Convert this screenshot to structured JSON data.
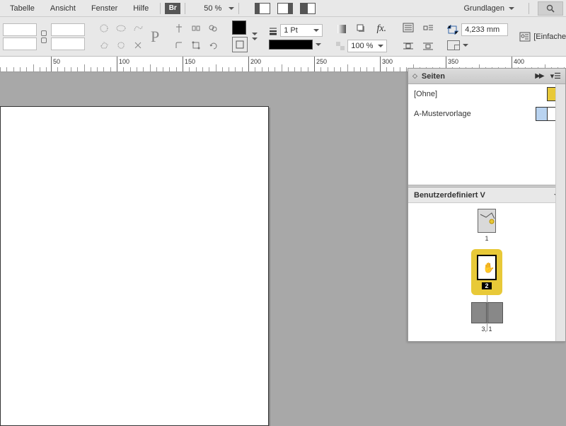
{
  "menu": {
    "items": [
      "Tabelle",
      "Ansicht",
      "Fenster",
      "Hilfe"
    ],
    "br": "Br",
    "zoom": "50 %",
    "workspace": "Grundlagen"
  },
  "toolbar": {
    "stroke_weight": "1 Pt",
    "opacity": "100 %",
    "mm_value": "4,233 mm",
    "graphic_style": "[Einfacher Grafik"
  },
  "ruler": {
    "ticks": [
      50,
      100,
      150,
      200,
      250,
      300,
      350,
      400
    ]
  },
  "panel": {
    "title": "Seiten",
    "masters": [
      {
        "name": "[Ohne]",
        "style": "yellow"
      },
      {
        "name": "A-Mustervorlage",
        "style": "double"
      }
    ],
    "sub_title": "Benutzerdefiniert V",
    "pages": [
      {
        "label": "1",
        "selected": false
      },
      {
        "label": "2",
        "selected": true
      },
      {
        "label": "3, 1",
        "selected": false,
        "spread": true
      }
    ]
  }
}
